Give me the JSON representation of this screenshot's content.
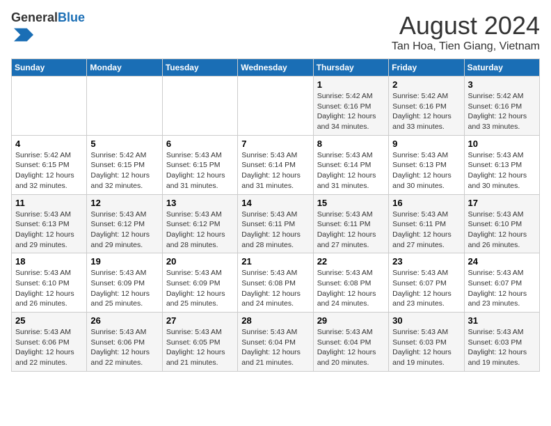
{
  "header": {
    "logo_general": "General",
    "logo_blue": "Blue",
    "month_title": "August 2024",
    "location": "Tan Hoa, Tien Giang, Vietnam"
  },
  "weekdays": [
    "Sunday",
    "Monday",
    "Tuesday",
    "Wednesday",
    "Thursday",
    "Friday",
    "Saturday"
  ],
  "weeks": [
    [
      {
        "day": "",
        "info": ""
      },
      {
        "day": "",
        "info": ""
      },
      {
        "day": "",
        "info": ""
      },
      {
        "day": "",
        "info": ""
      },
      {
        "day": "1",
        "info": "Sunrise: 5:42 AM\nSunset: 6:16 PM\nDaylight: 12 hours\nand 34 minutes."
      },
      {
        "day": "2",
        "info": "Sunrise: 5:42 AM\nSunset: 6:16 PM\nDaylight: 12 hours\nand 33 minutes."
      },
      {
        "day": "3",
        "info": "Sunrise: 5:42 AM\nSunset: 6:16 PM\nDaylight: 12 hours\nand 33 minutes."
      }
    ],
    [
      {
        "day": "4",
        "info": "Sunrise: 5:42 AM\nSunset: 6:15 PM\nDaylight: 12 hours\nand 32 minutes."
      },
      {
        "day": "5",
        "info": "Sunrise: 5:42 AM\nSunset: 6:15 PM\nDaylight: 12 hours\nand 32 minutes."
      },
      {
        "day": "6",
        "info": "Sunrise: 5:43 AM\nSunset: 6:15 PM\nDaylight: 12 hours\nand 31 minutes."
      },
      {
        "day": "7",
        "info": "Sunrise: 5:43 AM\nSunset: 6:14 PM\nDaylight: 12 hours\nand 31 minutes."
      },
      {
        "day": "8",
        "info": "Sunrise: 5:43 AM\nSunset: 6:14 PM\nDaylight: 12 hours\nand 31 minutes."
      },
      {
        "day": "9",
        "info": "Sunrise: 5:43 AM\nSunset: 6:13 PM\nDaylight: 12 hours\nand 30 minutes."
      },
      {
        "day": "10",
        "info": "Sunrise: 5:43 AM\nSunset: 6:13 PM\nDaylight: 12 hours\nand 30 minutes."
      }
    ],
    [
      {
        "day": "11",
        "info": "Sunrise: 5:43 AM\nSunset: 6:13 PM\nDaylight: 12 hours\nand 29 minutes."
      },
      {
        "day": "12",
        "info": "Sunrise: 5:43 AM\nSunset: 6:12 PM\nDaylight: 12 hours\nand 29 minutes."
      },
      {
        "day": "13",
        "info": "Sunrise: 5:43 AM\nSunset: 6:12 PM\nDaylight: 12 hours\nand 28 minutes."
      },
      {
        "day": "14",
        "info": "Sunrise: 5:43 AM\nSunset: 6:11 PM\nDaylight: 12 hours\nand 28 minutes."
      },
      {
        "day": "15",
        "info": "Sunrise: 5:43 AM\nSunset: 6:11 PM\nDaylight: 12 hours\nand 27 minutes."
      },
      {
        "day": "16",
        "info": "Sunrise: 5:43 AM\nSunset: 6:11 PM\nDaylight: 12 hours\nand 27 minutes."
      },
      {
        "day": "17",
        "info": "Sunrise: 5:43 AM\nSunset: 6:10 PM\nDaylight: 12 hours\nand 26 minutes."
      }
    ],
    [
      {
        "day": "18",
        "info": "Sunrise: 5:43 AM\nSunset: 6:10 PM\nDaylight: 12 hours\nand 26 minutes."
      },
      {
        "day": "19",
        "info": "Sunrise: 5:43 AM\nSunset: 6:09 PM\nDaylight: 12 hours\nand 25 minutes."
      },
      {
        "day": "20",
        "info": "Sunrise: 5:43 AM\nSunset: 6:09 PM\nDaylight: 12 hours\nand 25 minutes."
      },
      {
        "day": "21",
        "info": "Sunrise: 5:43 AM\nSunset: 6:08 PM\nDaylight: 12 hours\nand 24 minutes."
      },
      {
        "day": "22",
        "info": "Sunrise: 5:43 AM\nSunset: 6:08 PM\nDaylight: 12 hours\nand 24 minutes."
      },
      {
        "day": "23",
        "info": "Sunrise: 5:43 AM\nSunset: 6:07 PM\nDaylight: 12 hours\nand 23 minutes."
      },
      {
        "day": "24",
        "info": "Sunrise: 5:43 AM\nSunset: 6:07 PM\nDaylight: 12 hours\nand 23 minutes."
      }
    ],
    [
      {
        "day": "25",
        "info": "Sunrise: 5:43 AM\nSunset: 6:06 PM\nDaylight: 12 hours\nand 22 minutes."
      },
      {
        "day": "26",
        "info": "Sunrise: 5:43 AM\nSunset: 6:06 PM\nDaylight: 12 hours\nand 22 minutes."
      },
      {
        "day": "27",
        "info": "Sunrise: 5:43 AM\nSunset: 6:05 PM\nDaylight: 12 hours\nand 21 minutes."
      },
      {
        "day": "28",
        "info": "Sunrise: 5:43 AM\nSunset: 6:04 PM\nDaylight: 12 hours\nand 21 minutes."
      },
      {
        "day": "29",
        "info": "Sunrise: 5:43 AM\nSunset: 6:04 PM\nDaylight: 12 hours\nand 20 minutes."
      },
      {
        "day": "30",
        "info": "Sunrise: 5:43 AM\nSunset: 6:03 PM\nDaylight: 12 hours\nand 19 minutes."
      },
      {
        "day": "31",
        "info": "Sunrise: 5:43 AM\nSunset: 6:03 PM\nDaylight: 12 hours\nand 19 minutes."
      }
    ]
  ]
}
